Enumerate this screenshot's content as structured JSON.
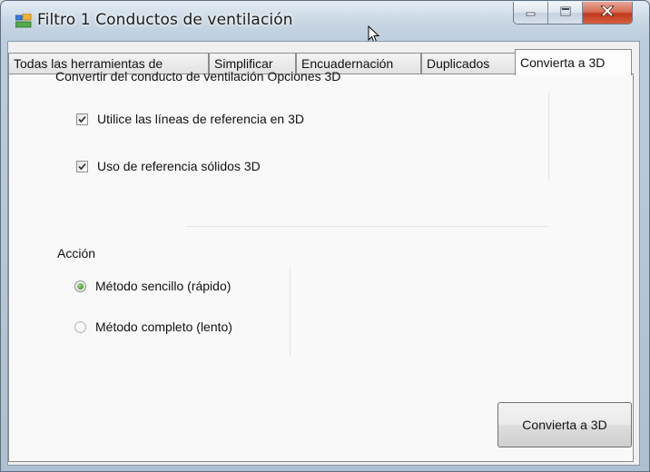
{
  "window": {
    "title": "Filtro  1 Conductos de ventilación",
    "icon": "window-app-icon",
    "caption_buttons": [
      "minimize-icon",
      "maximize-icon",
      "close-icon"
    ]
  },
  "tabs": [
    {
      "label": "Todas las herramientas de",
      "active": false
    },
    {
      "label": "Simplificar",
      "active": false
    },
    {
      "label": "Encuadernación",
      "active": false
    },
    {
      "label": "Duplicados",
      "active": false
    },
    {
      "label": "Convierta a 3D",
      "active": true
    }
  ],
  "options3d": {
    "heading": "Convertir del conducto de ventilación Opciones 3D",
    "use_lines_label": "Utilice las líneas de referencia en 3D",
    "use_lines_checked": true,
    "use_solids_label": "Uso de referencia sólidos 3D",
    "use_solids_checked": true
  },
  "action": {
    "heading": "Acción",
    "options": [
      {
        "label": "Método sencillo (rápido)",
        "selected": true
      },
      {
        "label": "Método completo (lento)",
        "selected": false
      }
    ]
  },
  "convert_button_label": "Convierta a 3D",
  "colors": {
    "close_button": "#c1391d",
    "radio_selected": "#2b7a15",
    "panel_bg": "#f9f9f9"
  }
}
